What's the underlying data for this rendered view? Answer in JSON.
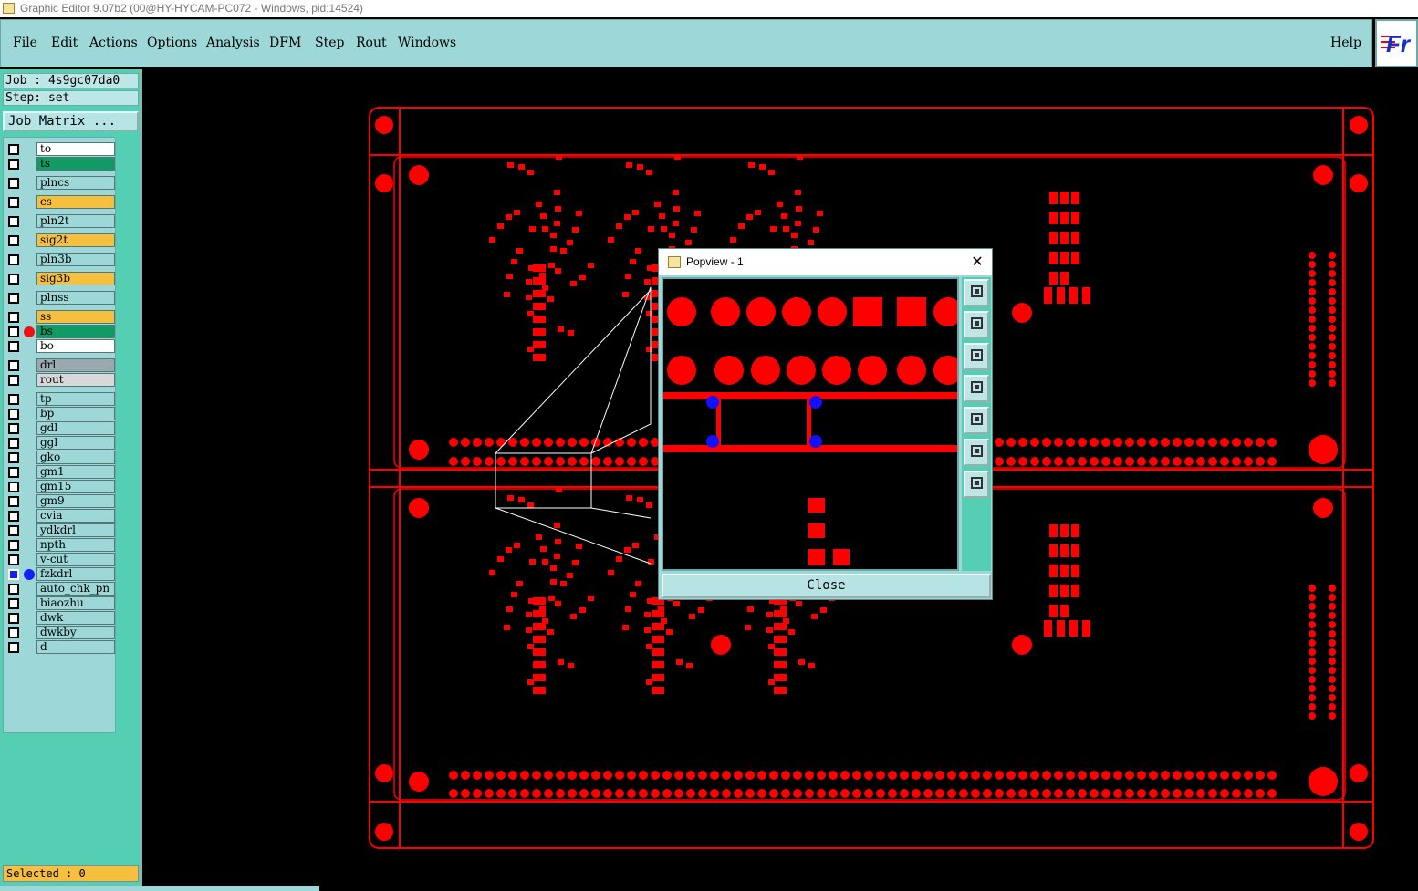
{
  "window": {
    "title": "Graphic Editor 9.07b2 (00@HY-HYCAM-PC072 - Windows, pid:14524)"
  },
  "menu": {
    "items": [
      "File",
      "Edit",
      "Actions",
      "Options",
      "Analysis",
      "DFM",
      "Step",
      "Rout",
      "Windows"
    ],
    "help": "Help"
  },
  "logo": {
    "text": "Fr"
  },
  "info": {
    "job": "Job : 4s9gc07da0",
    "step": "Step: set",
    "job_matrix": "Job Matrix ..."
  },
  "layers": [
    {
      "name": "to",
      "color": "#ffffff"
    },
    {
      "name": "ts",
      "color": "#119966"
    },
    {
      "name": "plncs",
      "color": "#9dd7d7"
    },
    {
      "name": "cs",
      "color": "#f5c040"
    },
    {
      "name": "pln2t",
      "color": "#9dd7d7"
    },
    {
      "name": "sig2t",
      "color": "#f5c040"
    },
    {
      "name": "pln3b",
      "color": "#9dd7d7"
    },
    {
      "name": "sig3b",
      "color": "#f5c040"
    },
    {
      "name": "plnss",
      "color": "#9dd7d7"
    },
    {
      "name": "ss",
      "color": "#f5c040"
    },
    {
      "name": "bs",
      "color": "#119966",
      "marker": "#ee1111"
    },
    {
      "name": "bo",
      "color": "#ffffff"
    },
    {
      "name": "drl",
      "color": "#9aa8b0"
    },
    {
      "name": "rout",
      "color": "#d8d8d8"
    },
    {
      "name": "tp",
      "color": "#9dd7d7"
    },
    {
      "name": "bp",
      "color": "#9dd7d7"
    },
    {
      "name": "gdl",
      "color": "#9dd7d7"
    },
    {
      "name": "ggl",
      "color": "#9dd7d7"
    },
    {
      "name": "gko",
      "color": "#9dd7d7"
    },
    {
      "name": "gm1",
      "color": "#9dd7d7"
    },
    {
      "name": "gm15",
      "color": "#9dd7d7"
    },
    {
      "name": "gm9",
      "color": "#9dd7d7"
    },
    {
      "name": "cvia",
      "color": "#9dd7d7"
    },
    {
      "name": "ydkdrl",
      "color": "#9dd7d7"
    },
    {
      "name": "npth",
      "color": "#9dd7d7"
    },
    {
      "name": "v-cut",
      "color": "#9dd7d7"
    },
    {
      "name": "fzkdrl",
      "color": "#9dd7d7",
      "marker": "#1122ee",
      "checkbox": "#1122ee"
    },
    {
      "name": "auto_chk_pn",
      "color": "#9dd7d7"
    },
    {
      "name": "biaozhu",
      "color": "#9dd7d7"
    },
    {
      "name": "dwk",
      "color": "#9dd7d7"
    },
    {
      "name": "dwkby",
      "color": "#9dd7d7"
    },
    {
      "name": "d",
      "color": "#9dd7d7"
    }
  ],
  "status": {
    "selected": "Selected : 0"
  },
  "popview": {
    "title": "Popview - 1",
    "close_label": "Close",
    "tools": [
      "zoom-window-icon",
      "pan-up-icon",
      "pan-down-icon",
      "pan-left-icon",
      "pan-right-icon",
      "zoom-fit-icon",
      "zoom-home-icon"
    ]
  },
  "colors": {
    "feature": "#ff0000",
    "highlight": "#1111ff",
    "panel": "#9dd7d7",
    "panel_dark": "#55cfb4"
  }
}
